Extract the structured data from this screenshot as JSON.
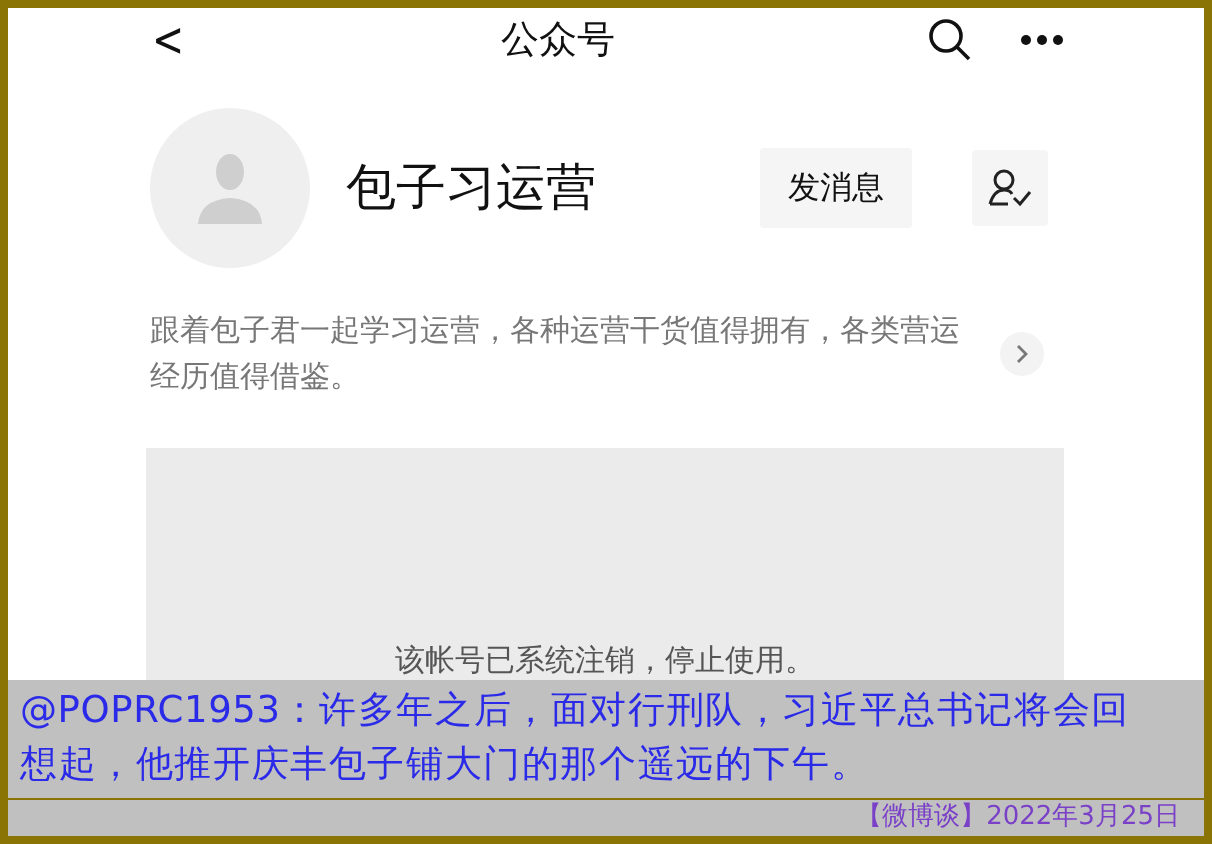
{
  "nav_bar": {
    "back": "<",
    "title": "公众号"
  },
  "profile": {
    "name": "包子习运营",
    "message_button": "发消息",
    "description": "跟着包子君一起学习运营，各种运营干货值得拥有，各类营运经历值得借鉴。"
  },
  "notice": {
    "text": "该帐号已系统注销，停止使用。"
  },
  "caption": {
    "text": "@POPRC1953：许多年之后，面对行刑队，习近平总书记将会回想起，他推开庆丰包子铺大门的那个遥远的下午。",
    "source": "【微博谈】2022年3月25日"
  }
}
